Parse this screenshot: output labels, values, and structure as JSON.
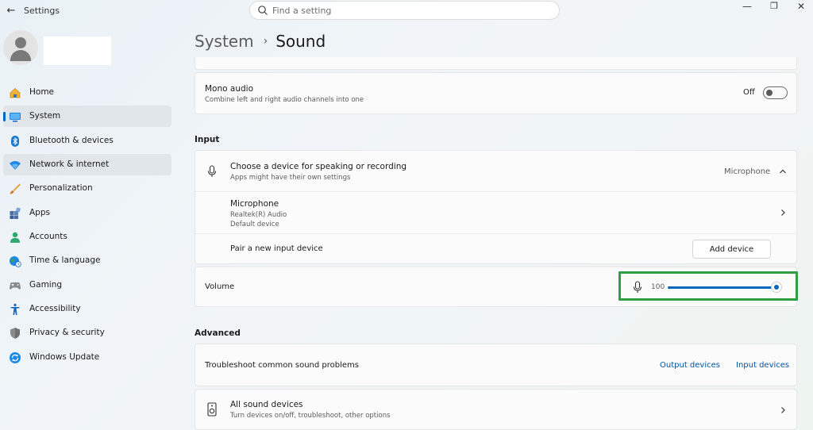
{
  "window": {
    "title": "Settings",
    "back_glyph": "←",
    "minimize_glyph": "—",
    "restore_glyph": "❐",
    "close_glyph": "✕"
  },
  "search": {
    "placeholder": "Find a setting",
    "value": ""
  },
  "user": {
    "avatar_icon": "person-icon",
    "name": ""
  },
  "sidebar": {
    "items": [
      {
        "label": "Home",
        "icon": "home-icon",
        "active": false
      },
      {
        "label": "System",
        "icon": "system-icon",
        "active": true
      },
      {
        "label": "Bluetooth & devices",
        "icon": "bluetooth-icon",
        "active": false
      },
      {
        "label": "Network & internet",
        "icon": "wifi-icon",
        "active": false
      },
      {
        "label": "Personalization",
        "icon": "brush-icon",
        "active": false
      },
      {
        "label": "Apps",
        "icon": "apps-icon",
        "active": false
      },
      {
        "label": "Accounts",
        "icon": "accounts-icon",
        "active": false
      },
      {
        "label": "Time & language",
        "icon": "globe-icon",
        "active": false
      },
      {
        "label": "Gaming",
        "icon": "gamepad-icon",
        "active": false
      },
      {
        "label": "Accessibility",
        "icon": "accessibility-icon",
        "active": false
      },
      {
        "label": "Privacy & security",
        "icon": "shield-icon",
        "active": false
      },
      {
        "label": "Windows Update",
        "icon": "update-icon",
        "active": false
      }
    ]
  },
  "breadcrumb": {
    "parent": "System",
    "separator": "›",
    "current": "Sound"
  },
  "mono_audio": {
    "title": "Mono audio",
    "subtitle": "Combine left and right audio channels into one",
    "state_label": "Off",
    "on": false
  },
  "input": {
    "section_title": "Input",
    "chooser": {
      "title": "Choose a device for speaking or recording",
      "subtitle": "Apps might have their own settings",
      "selected": "Microphone",
      "expanded": true
    },
    "device": {
      "name": "Microphone",
      "driver": "Realtek(R) Audio",
      "status": "Default device"
    },
    "pair": {
      "label": "Pair a new input device",
      "button": "Add device"
    },
    "volume": {
      "label": "Volume",
      "value_text": "100",
      "level": 1.0
    }
  },
  "advanced": {
    "section_title": "Advanced",
    "troubleshoot": {
      "label": "Troubleshoot common sound problems",
      "output_link": "Output devices",
      "input_link": "Input devices"
    },
    "all_devices": {
      "title": "All sound devices",
      "subtitle": "Turn devices on/off, troubleshoot, other options"
    }
  },
  "colors": {
    "accent": "#0067c0",
    "highlight": "#2ea043",
    "link": "#0054a6"
  }
}
